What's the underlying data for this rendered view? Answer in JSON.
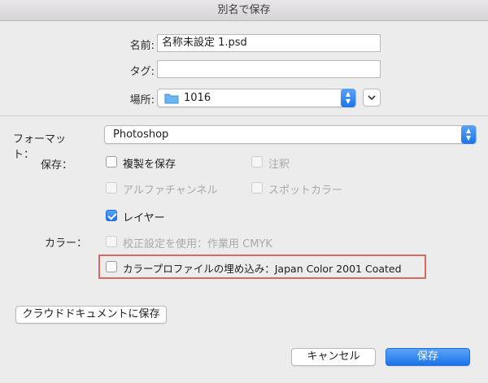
{
  "window": {
    "title": "別名で保存"
  },
  "top": {
    "name_label": "名前:",
    "name_value": "名称未設定 1.psd",
    "tags_label": "タグ:",
    "tags_value": "",
    "location_label": "場所:",
    "location_value": "1016",
    "location_icon": "folder-icon",
    "expand_icon": "chevron-down-icon"
  },
  "format": {
    "label": "フォーマット：",
    "value": "Photoshop"
  },
  "save_options": {
    "label": "保存：",
    "items": [
      {
        "label": "複製を保存",
        "checked": false,
        "enabled": true
      },
      {
        "label": "注釈",
        "checked": false,
        "enabled": false
      },
      {
        "label": "アルファチャンネル",
        "checked": false,
        "enabled": false
      },
      {
        "label": "スポットカラー",
        "checked": false,
        "enabled": false
      },
      {
        "label": "レイヤー",
        "checked": true,
        "enabled": true
      }
    ]
  },
  "color_options": {
    "label": "カラー：",
    "items": [
      {
        "label": "校正設定を使用：作業用 CMYK",
        "checked": false,
        "enabled": false
      },
      {
        "label": "カラープロファイルの埋め込み：Japan Color 2001 Coated",
        "checked": false,
        "enabled": true
      }
    ]
  },
  "buttons": {
    "cloud": "クラウドドキュメントに保存",
    "cancel": "キャンセル",
    "save": "保存"
  },
  "colors": {
    "accent": "#1d74e8",
    "highlight_border": "#d56b5f"
  }
}
